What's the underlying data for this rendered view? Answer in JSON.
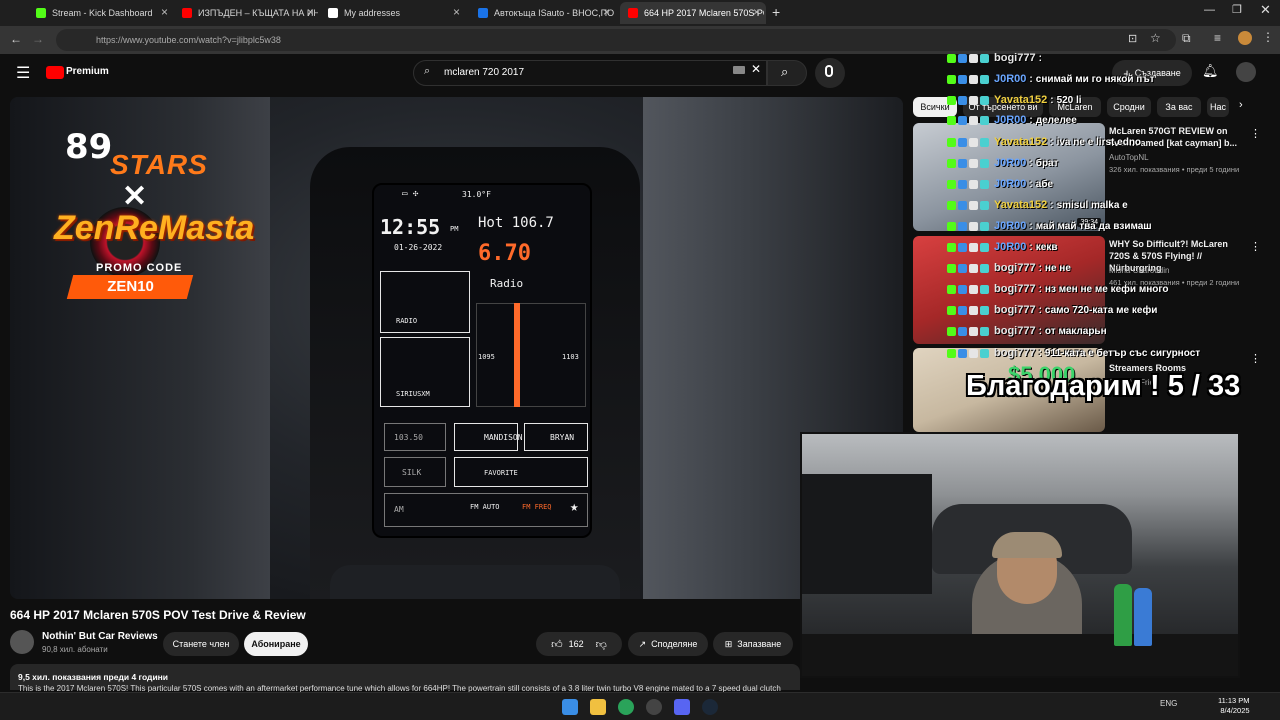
{
  "browser": {
    "tabs": [
      {
        "label": "Stream - Kick Dashboard",
        "favicon_color": "#53fc18"
      },
      {
        "label": "ИЗПЪДЕН – КЪЩАТА НА ИНО",
        "favicon_color": "#ff0000"
      },
      {
        "label": "My addresses",
        "favicon_color": "#ffffff"
      },
      {
        "label": "Автокъща ISauto - ВНОС,ПО",
        "favicon_color": "#1a73e8"
      },
      {
        "label": "664 HP 2017 Mclaren 570S POV",
        "favicon_color": "#ff0000"
      }
    ],
    "new_tab": "+",
    "url": "https://www.youtube.com/watch?v=jlibplc5w38"
  },
  "youtube": {
    "logo_text": "Premium",
    "search_value": "mclaren 720 2017",
    "create_label": "Създаване"
  },
  "overlay": {
    "logo_number": "89",
    "logo_word": "STARS",
    "logo_x": "✕",
    "sponsor": "ZenReMasta",
    "promo_label": "PROMO CODE",
    "promo_code": "ZEN10"
  },
  "player_screen": {
    "time": "12:55",
    "ampm": "PM",
    "date": "01-26-2022",
    "station": "Hot 106.7",
    "frequency": "6.70",
    "temp": "31.0°F",
    "radio_label": "Radio",
    "left_tile": "RADIO",
    "left_tile2": "SIRIUSXM",
    "freq_left": "1095",
    "freq_right": "1103",
    "preset1": "103.50",
    "preset2": "MANDISON",
    "preset3": "BRYAN",
    "preset4": "SILK",
    "preset5": "FAVORITE",
    "preset6": "AM",
    "preset7": "FM AUTO",
    "preset8": "FM FREQ"
  },
  "video": {
    "title": "664 HP 2017 Mclaren 570S POV Test Drive & Review",
    "channel": "Nothin' But Car Reviews",
    "subscribers": "90,8 хил. абонати",
    "join_label": "Станете член",
    "subscribe_label": "Абониране",
    "likes": "162",
    "share_label": "Споделяне",
    "save_label": "Запазване",
    "views_date": "9,5 хил. показвания  преди 4 години",
    "description": "This is the 2017 Mclaren 570S! This particular 570S comes with an aftermarket performance tune which allows for 664HP! The powertrain still consists of a 3.8 liter twin turbo V8 engine mated to a 7 speed dual clutch"
  },
  "chips": [
    "Всички",
    "От търсенето ви",
    "McLaren",
    "Сродни",
    "За вас",
    "Нас"
  ],
  "recommendations": [
    {
      "title": "McLaren 570GT REVIEW on livestreamed [kat cayman] b...",
      "channel": "AutoTopNL",
      "meta": "326 хил. показвания • преди 5 години",
      "duration": "39:34",
      "thumb_color": "#8c95a0"
    },
    {
      "title": "WHY So Difficult?! McLaren 720S & 570S Flying! // Nürburgring",
      "channel": "Misha Charoudin",
      "meta": "461 хил. показвания • преди 2 години",
      "duration": "",
      "thumb_color": "#a52828"
    },
    {
      "title": "Streamers Rooms",
      "channel": "FrenchieFries",
      "meta": "",
      "duration": "",
      "thumb_color": "#c7b8a0"
    }
  ],
  "chat": [
    {
      "user": "bogi777",
      "msg": "",
      "color": "#e6e6e6"
    },
    {
      "user": "J0R00",
      "msg": "снимай ми го някой път",
      "color": "#6aa6ff"
    },
    {
      "user": "Yavata152",
      "msg": "520 li",
      "color": "#f0d040"
    },
    {
      "user": "J0R00",
      "msg": "делелее",
      "color": "#6aa6ff"
    },
    {
      "user": "Yavata152",
      "msg": "iva ne e lirst edno",
      "color": "#f0d040"
    },
    {
      "user": "J0R00",
      "msg": "брат",
      "color": "#6aa6ff"
    },
    {
      "user": "J0R00",
      "msg": "абе",
      "color": "#6aa6ff"
    },
    {
      "user": "Yavata152",
      "msg": "smisul malka e",
      "color": "#f0d040"
    },
    {
      "user": "J0R00",
      "msg": "май май тва да взимаш",
      "color": "#6aa6ff"
    },
    {
      "user": "J0R00",
      "msg": "кекв",
      "color": "#6aa6ff"
    },
    {
      "user": "bogi777",
      "msg": "не не",
      "color": "#e6e6e6"
    },
    {
      "user": "bogi777",
      "msg": "нз мен не ме кефи много",
      "color": "#e6e6e6"
    },
    {
      "user": "bogi777",
      "msg": "само 720-ката ме кефи",
      "color": "#e6e6e6"
    },
    {
      "user": "bogi777",
      "msg": "от макларьн",
      "color": "#e6e6e6"
    },
    {
      "user": "bogi777",
      "msg": "911-ката е бетър със сигурност",
      "color": "#e6e6e6"
    }
  ],
  "alert": {
    "amount": "$5,000",
    "text": "Благодарим ! 5 / 33"
  },
  "taskbar": {
    "lang": "ENG",
    "time": "11:13 PM",
    "date": "8/4/2025"
  }
}
